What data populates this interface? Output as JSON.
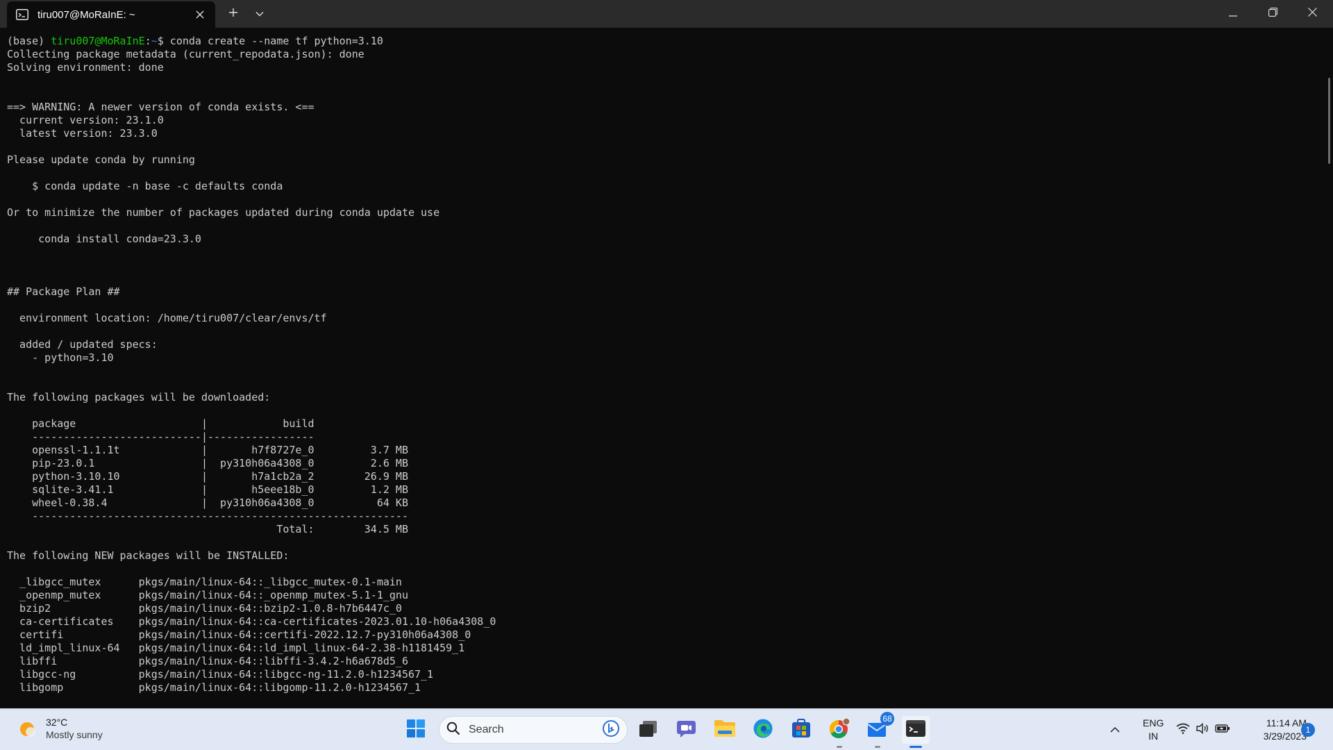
{
  "tab": {
    "title": "tiru007@MoRaInE: ~"
  },
  "terminal": {
    "prompt_prefix": "(base) ",
    "prompt_user": "tiru007@MoRaInE",
    "prompt_sep": ":",
    "prompt_path": "~",
    "prompt_command": "$ conda create --name tf python=3.10",
    "output": "Collecting package metadata (current_repodata.json): done\nSolving environment: done\n\n\n==> WARNING: A newer version of conda exists. <==\n  current version: 23.1.0\n  latest version: 23.3.0\n\nPlease update conda by running\n\n    $ conda update -n base -c defaults conda\n\nOr to minimize the number of packages updated during conda update use\n\n     conda install conda=23.3.0\n\n\n\n## Package Plan ##\n\n  environment location: /home/tiru007/clear/envs/tf\n\n  added / updated specs:\n    - python=3.10\n\n\nThe following packages will be downloaded:\n\n    package                    |            build\n    ---------------------------|-----------------\n    openssl-1.1.1t             |       h7f8727e_0         3.7 MB\n    pip-23.0.1                 |  py310h06a4308_0         2.6 MB\n    python-3.10.10             |       h7a1cb2a_2        26.9 MB\n    sqlite-3.41.1              |       h5eee18b_0         1.2 MB\n    wheel-0.38.4               |  py310h06a4308_0          64 KB\n    ------------------------------------------------------------\n                                           Total:        34.5 MB\n\nThe following NEW packages will be INSTALLED:\n\n  _libgcc_mutex      pkgs/main/linux-64::_libgcc_mutex-0.1-main\n  _openmp_mutex      pkgs/main/linux-64::_openmp_mutex-5.1-1_gnu\n  bzip2              pkgs/main/linux-64::bzip2-1.0.8-h7b6447c_0\n  ca-certificates    pkgs/main/linux-64::ca-certificates-2023.01.10-h06a4308_0\n  certifi            pkgs/main/linux-64::certifi-2022.12.7-py310h06a4308_0\n  ld_impl_linux-64   pkgs/main/linux-64::ld_impl_linux-64-2.38-h1181459_1\n  libffi             pkgs/main/linux-64::libffi-3.4.2-h6a678d5_6\n  libgcc-ng          pkgs/main/linux-64::libgcc-ng-11.2.0-h1234567_1\n  libgomp            pkgs/main/linux-64::libgomp-11.2.0-h1234567_1"
  },
  "taskbar": {
    "weather": {
      "temperature": "32°C",
      "condition": "Mostly sunny"
    },
    "search": {
      "placeholder": "Search"
    },
    "mail_badge": "68",
    "language": {
      "line1": "ENG",
      "line2": "IN"
    },
    "clock": {
      "time": "11:14 AM",
      "date": "3/29/2023"
    },
    "notification_count": "1"
  },
  "colors": {
    "terminal_bg": "#0c0c0c",
    "titlebar_bg": "#2b2b2b",
    "prompt_user": "#16c60c",
    "prompt_path": "#3b78ff",
    "taskbar_bg": "#dfe8f4",
    "accent": "#1f6fd1"
  },
  "icons": [
    "terminal-tab-icon",
    "close-icon",
    "plus-icon",
    "chevron-down-icon",
    "minimize-icon",
    "restore-icon",
    "close-window-icon",
    "weather-sun-icon",
    "windows-start-icon",
    "search-icon",
    "bing-icon",
    "task-view-icon",
    "teams-chat-icon",
    "file-explorer-icon",
    "edge-icon",
    "store-icon",
    "chrome-icon",
    "mail-icon",
    "terminal-icon",
    "chevron-up-icon",
    "wifi-icon",
    "volume-icon",
    "battery-icon"
  ]
}
